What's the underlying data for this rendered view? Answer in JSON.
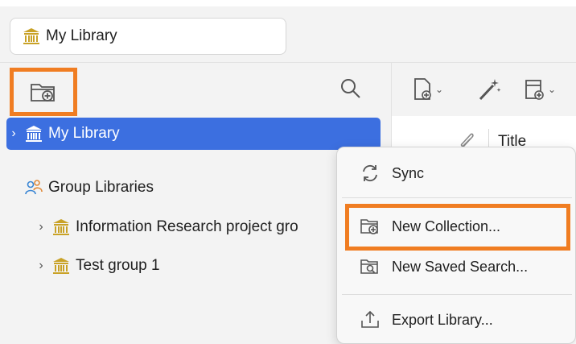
{
  "library_tab": {
    "label": "My Library"
  },
  "tree": {
    "my_library": "My Library",
    "group_libraries": "Group Libraries",
    "groups": [
      {
        "label": "Information Research project gro"
      },
      {
        "label": "Test group 1"
      }
    ]
  },
  "items_pane": {
    "title_column": "Title"
  },
  "context_menu": {
    "sync": "Sync",
    "new_collection": "New Collection...",
    "new_saved_search": "New Saved Search...",
    "export_library": "Export Library..."
  },
  "colors": {
    "accent": "#3c6fe0",
    "highlight": "#f07d22",
    "library_icon": "#c9a227",
    "group_icon": "#3a86d4"
  }
}
